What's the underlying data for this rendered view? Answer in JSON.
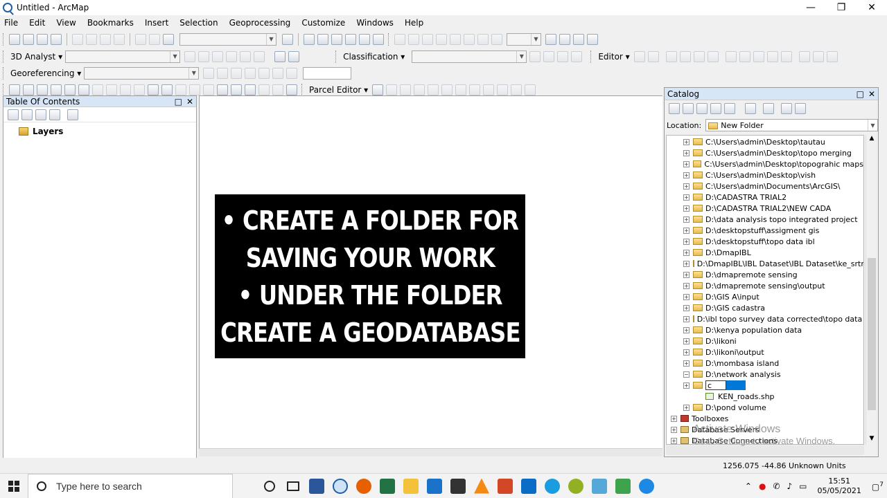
{
  "window": {
    "title": "Untitled - ArcMap",
    "controls": [
      "—",
      "❐",
      "✕"
    ]
  },
  "menu": [
    "File",
    "Edit",
    "View",
    "Bookmarks",
    "Insert",
    "Selection",
    "Geoprocessing",
    "Customize",
    "Windows",
    "Help"
  ],
  "toolbars": {
    "analyst_label": "3D Analyst ▾",
    "classification_label": "Classification ▾",
    "editor_label": "Editor ▾",
    "georef_label": "Georeferencing ▾",
    "parcel_label": "Parcel Editor ▾"
  },
  "toc": {
    "title": "Table Of Contents",
    "layers_label": "Layers"
  },
  "slide": {
    "lines": [
      "• CREATE A FOLDER FOR",
      "SAVING YOUR WORK",
      "• UNDER THE FOLDER",
      "CREATE A GEODATABASE"
    ]
  },
  "catalog": {
    "title": "Catalog",
    "location_label": "Location:",
    "location_value": "New Folder",
    "items": [
      "C:\\Users\\admin\\Desktop\\tautau",
      "C:\\Users\\admin\\Desktop\\topo merging",
      "C:\\Users\\admin\\Desktop\\topograhic maps",
      "C:\\Users\\admin\\Desktop\\vish",
      "C:\\Users\\admin\\Documents\\ArcGIS\\",
      "D:\\CADASTRA TRIAL2",
      "D:\\CADASTRA TRIAL2\\NEW CADA",
      "D:\\data analysis topo integrated project",
      "D:\\desktopstuff\\assigment gis",
      "D:\\desktopstuff\\topo data ibl",
      "D:\\DmapIBL",
      "D:\\DmapIBL\\IBL Dataset\\IBL Dataset\\ke_srtm\\",
      "D:\\dmapremote sensing",
      "D:\\dmapremote sensing\\output",
      "D:\\GIS A\\input",
      "D:\\GIS cadastra",
      "D:\\ibl topo survey data corrected\\topo data ib",
      "D:\\kenya population data",
      "D:\\likoni",
      "D:\\likoni\\output",
      "D:\\mombasa island",
      "D:\\network analysis"
    ],
    "editing_value": "c",
    "shapefile": "KEN_roads.shp",
    "after_items": [
      "D:\\pond volume"
    ],
    "roots": [
      "Toolboxes",
      "Database Servers",
      "Database Connections"
    ]
  },
  "watermark": {
    "line1": "Activate Windows",
    "line2": "Go to Settings to activate Windows."
  },
  "status": {
    "coords": "1256.075  -44.86 Unknown Units"
  },
  "taskbar": {
    "search_placeholder": "Type here to search",
    "time": "15:51",
    "date": "05/05/2021",
    "notif_count": "7"
  }
}
